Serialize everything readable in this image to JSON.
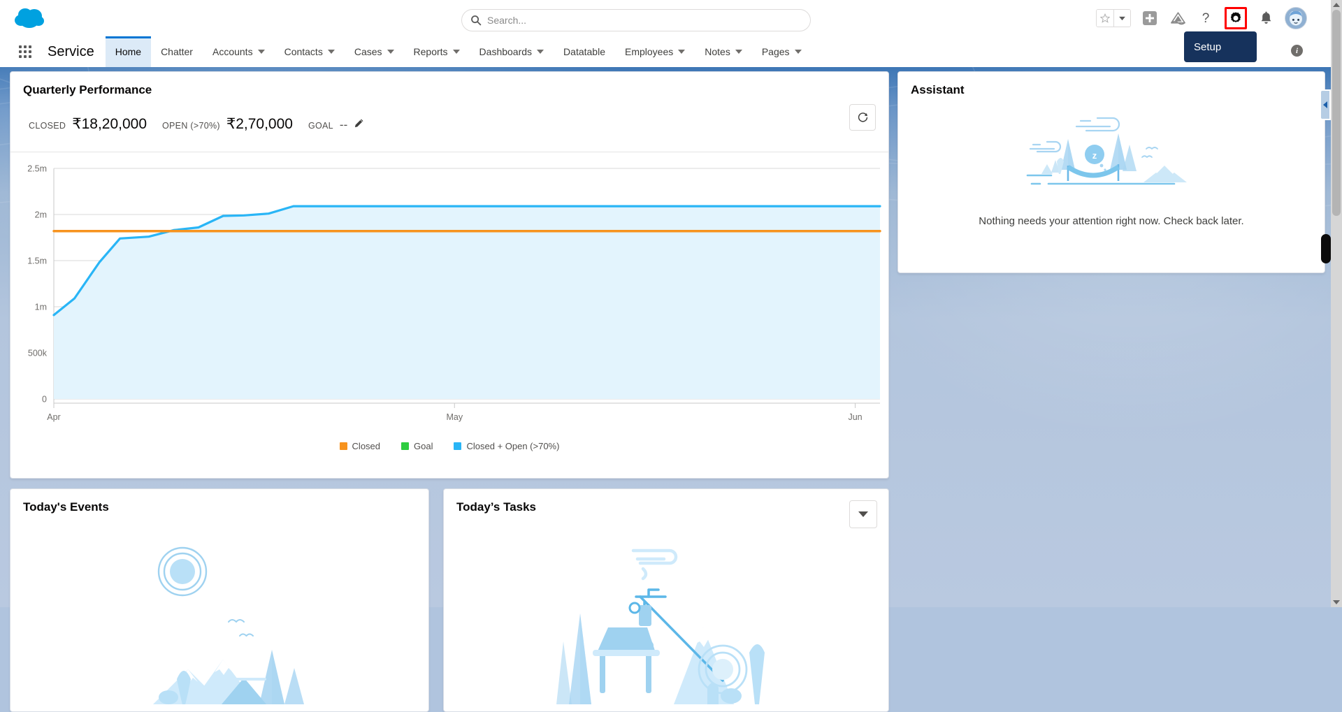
{
  "header": {
    "logo_icon": "salesforce-cloud-logo",
    "search": {
      "placeholder": "Search...",
      "value": "",
      "icon": "search-icon"
    },
    "icons": [
      {
        "name": "favorites-star-icon",
        "glyph": "star"
      },
      {
        "name": "favorites-dropdown-icon",
        "glyph": "caret-down"
      },
      {
        "name": "global-actions-plus-icon",
        "glyph": "plus"
      },
      {
        "name": "trailhead-icon",
        "glyph": "mountain"
      },
      {
        "name": "help-icon",
        "glyph": "question-mark"
      },
      {
        "name": "setup-gear-icon",
        "glyph": "gear"
      },
      {
        "name": "notifications-bell-icon",
        "glyph": "bell"
      },
      {
        "name": "user-avatar",
        "glyph": "astro-avatar"
      }
    ],
    "setup_tooltip": "Setup",
    "highlight_color": "#ff0000",
    "tooltip_bg": "#16325c",
    "info_icon_label": "i"
  },
  "nav": {
    "app_launcher_icon": "app-launcher-waffle-icon",
    "app_name": "Service",
    "items": [
      {
        "label": "Home",
        "has_caret": false,
        "active": true
      },
      {
        "label": "Chatter",
        "has_caret": false,
        "active": false
      },
      {
        "label": "Accounts",
        "has_caret": true,
        "active": false
      },
      {
        "label": "Contacts",
        "has_caret": true,
        "active": false
      },
      {
        "label": "Cases",
        "has_caret": true,
        "active": false
      },
      {
        "label": "Reports",
        "has_caret": true,
        "active": false
      },
      {
        "label": "Dashboards",
        "has_caret": true,
        "active": false
      },
      {
        "label": "Datatable",
        "has_caret": false,
        "active": false
      },
      {
        "label": "Employees",
        "has_caret": true,
        "active": false
      },
      {
        "label": "Notes",
        "has_caret": true,
        "active": false
      },
      {
        "label": "Pages",
        "has_caret": true,
        "active": false
      }
    ],
    "active_tab_bg": "#dceaf7",
    "active_tab_accent": "#0176d3"
  },
  "quarterly": {
    "title": "Quarterly Performance",
    "refresh_icon": "refresh-icon",
    "metrics": [
      {
        "label": "CLOSED",
        "value": "₹18,20,000"
      },
      {
        "label": "OPEN (>70%)",
        "value": "₹2,70,000"
      },
      {
        "label": "GOAL",
        "value": "--"
      }
    ],
    "edit_goal_icon": "pencil-icon"
  },
  "chart_data": {
    "type": "area",
    "title": "Quarterly Performance",
    "xlabel": "",
    "ylabel": "",
    "grid": true,
    "legend_position": "bottom",
    "ylim": [
      0,
      2500000
    ],
    "xlim": [
      "Apr",
      "Jun"
    ],
    "ytick_labels": [
      "0",
      "500k",
      "1m",
      "1.5m",
      "2m",
      "2.5m"
    ],
    "ytick_values": [
      0,
      500000,
      1000000,
      1500000,
      2000000,
      2500000
    ],
    "xtick_labels": [
      "Apr",
      "May",
      "Jun"
    ],
    "colors": {
      "closed": "#f7931e",
      "goal": "#2ecc40",
      "closed_open": "#29b5f6",
      "area_fill": "#e3f4fd"
    },
    "series": [
      {
        "name": "Closed",
        "color": "#f7931e",
        "x": [
          0,
          100
        ],
        "values": [
          1820000,
          1820000
        ]
      },
      {
        "name": "Goal",
        "color": "#2ecc40",
        "x": [],
        "values": []
      },
      {
        "name": "Closed + Open (>70%)",
        "color": "#29b5f6",
        "x": [
          0,
          2.5,
          5.5,
          8,
          11.5,
          14.5,
          17.5,
          20.5,
          23,
          26,
          29,
          100
        ],
        "values": [
          910000,
          1090000,
          1480000,
          1740000,
          1760000,
          1830000,
          1860000,
          1985000,
          1990000,
          2010000,
          2090000,
          2090000
        ]
      }
    ],
    "legend": [
      {
        "label": "Closed",
        "color": "#f7931e"
      },
      {
        "label": "Goal",
        "color": "#2ecc40"
      },
      {
        "label": "Closed + Open (>70%)",
        "color": "#29b5f6"
      }
    ]
  },
  "assistant": {
    "title": "Assistant",
    "message": "Nothing needs your attention right now. Check back later.",
    "illustration_icon": "hammock-trees-illustration"
  },
  "todays_events": {
    "title": "Today's Events",
    "illustration_icon": "camping-mountains-illustration"
  },
  "todays_tasks": {
    "title": "Today’s Tasks",
    "dropdown_icon": "chevron-down-icon",
    "illustration_icon": "campsite-crane-illustration"
  },
  "right_rail": {
    "collapse_icon": "collapse-panel-arrow-icon"
  },
  "scrollbar": {
    "up_icon": "scroll-up-arrow-icon",
    "down_icon": "scroll-down-arrow-icon"
  }
}
